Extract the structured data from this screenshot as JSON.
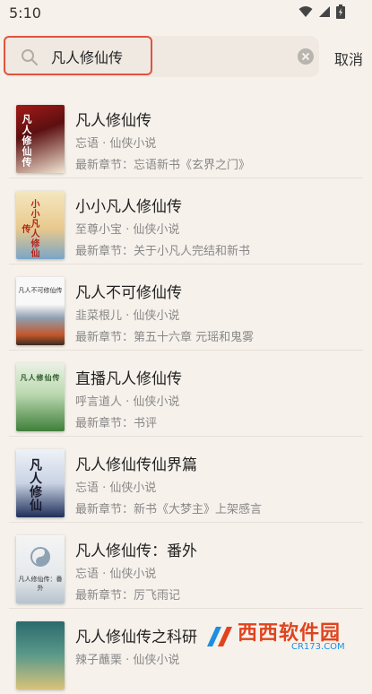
{
  "status_bar": {
    "time": "5:10",
    "icons": [
      "wifi-icon",
      "signal-icon",
      "battery-icon"
    ]
  },
  "search": {
    "value": "凡人修仙传",
    "cancel_label": "取消",
    "highlight_color": "#e2533d"
  },
  "results": [
    {
      "title": "凡人修仙传",
      "author": "忘语",
      "category": "仙侠小说",
      "meta": "忘语 · 仙侠小说",
      "latest": "最新章节：忘语新书《玄界之门》",
      "cover_text": "凡人修仙传",
      "cover_colors": [
        "#a41919",
        "#f2e6d4"
      ]
    },
    {
      "title": "小小凡人修仙传",
      "author": "至尊小宝",
      "category": "仙侠小说",
      "meta": "至尊小宝 · 仙侠小说",
      "latest": "最新章节：关于小凡人完结和新书",
      "cover_text": "小小凡人修仙传",
      "cover_colors": [
        "#f5e7c0",
        "#7aa5c8"
      ]
    },
    {
      "title": "凡人不可修仙传",
      "author": "韭菜根儿",
      "category": "仙侠小说",
      "meta": "韭菜根儿 · 仙侠小说",
      "latest": "最新章节：第五十六章 元瑶和鬼雾",
      "cover_text": "凡人不可修仙传",
      "cover_colors": [
        "#f8f8f8",
        "#c3572a"
      ]
    },
    {
      "title": "直播凡人修仙传",
      "author": "呼言道人",
      "category": "仙侠小说",
      "meta": "呼言道人 · 仙侠小说",
      "latest": "最新章节：书评",
      "cover_text": "凡人修仙传",
      "cover_colors": [
        "#e9f1e4",
        "#3f7f3a"
      ]
    },
    {
      "title": "凡人修仙传仙界篇",
      "author": "忘语",
      "category": "仙侠小说",
      "meta": "忘语 · 仙侠小说",
      "latest": "最新章节：新书《大梦主》上架感言",
      "cover_text": "凡人修仙",
      "cover_colors": [
        "#eef2f8",
        "#1f2f5a"
      ]
    },
    {
      "title": "凡人修仙传：番外",
      "author": "忘语",
      "category": "仙侠小说",
      "meta": "忘语 · 仙侠小说",
      "latest": "最新章节：厉飞雨记",
      "cover_text": "凡人修仙传：番外",
      "cover_colors": [
        "#f4f4f4",
        "#b6c3ce"
      ]
    },
    {
      "title": "凡人修仙传之科研",
      "author": "辣子蘸栗",
      "category": "仙侠小说",
      "meta": "辣子蘸栗 · 仙侠小说",
      "latest": "",
      "cover_text": "",
      "cover_colors": [
        "#2a6a6e",
        "#d9c27a"
      ]
    }
  ],
  "watermark": {
    "brand": "西西软件园",
    "domain": "CR173.COM"
  }
}
